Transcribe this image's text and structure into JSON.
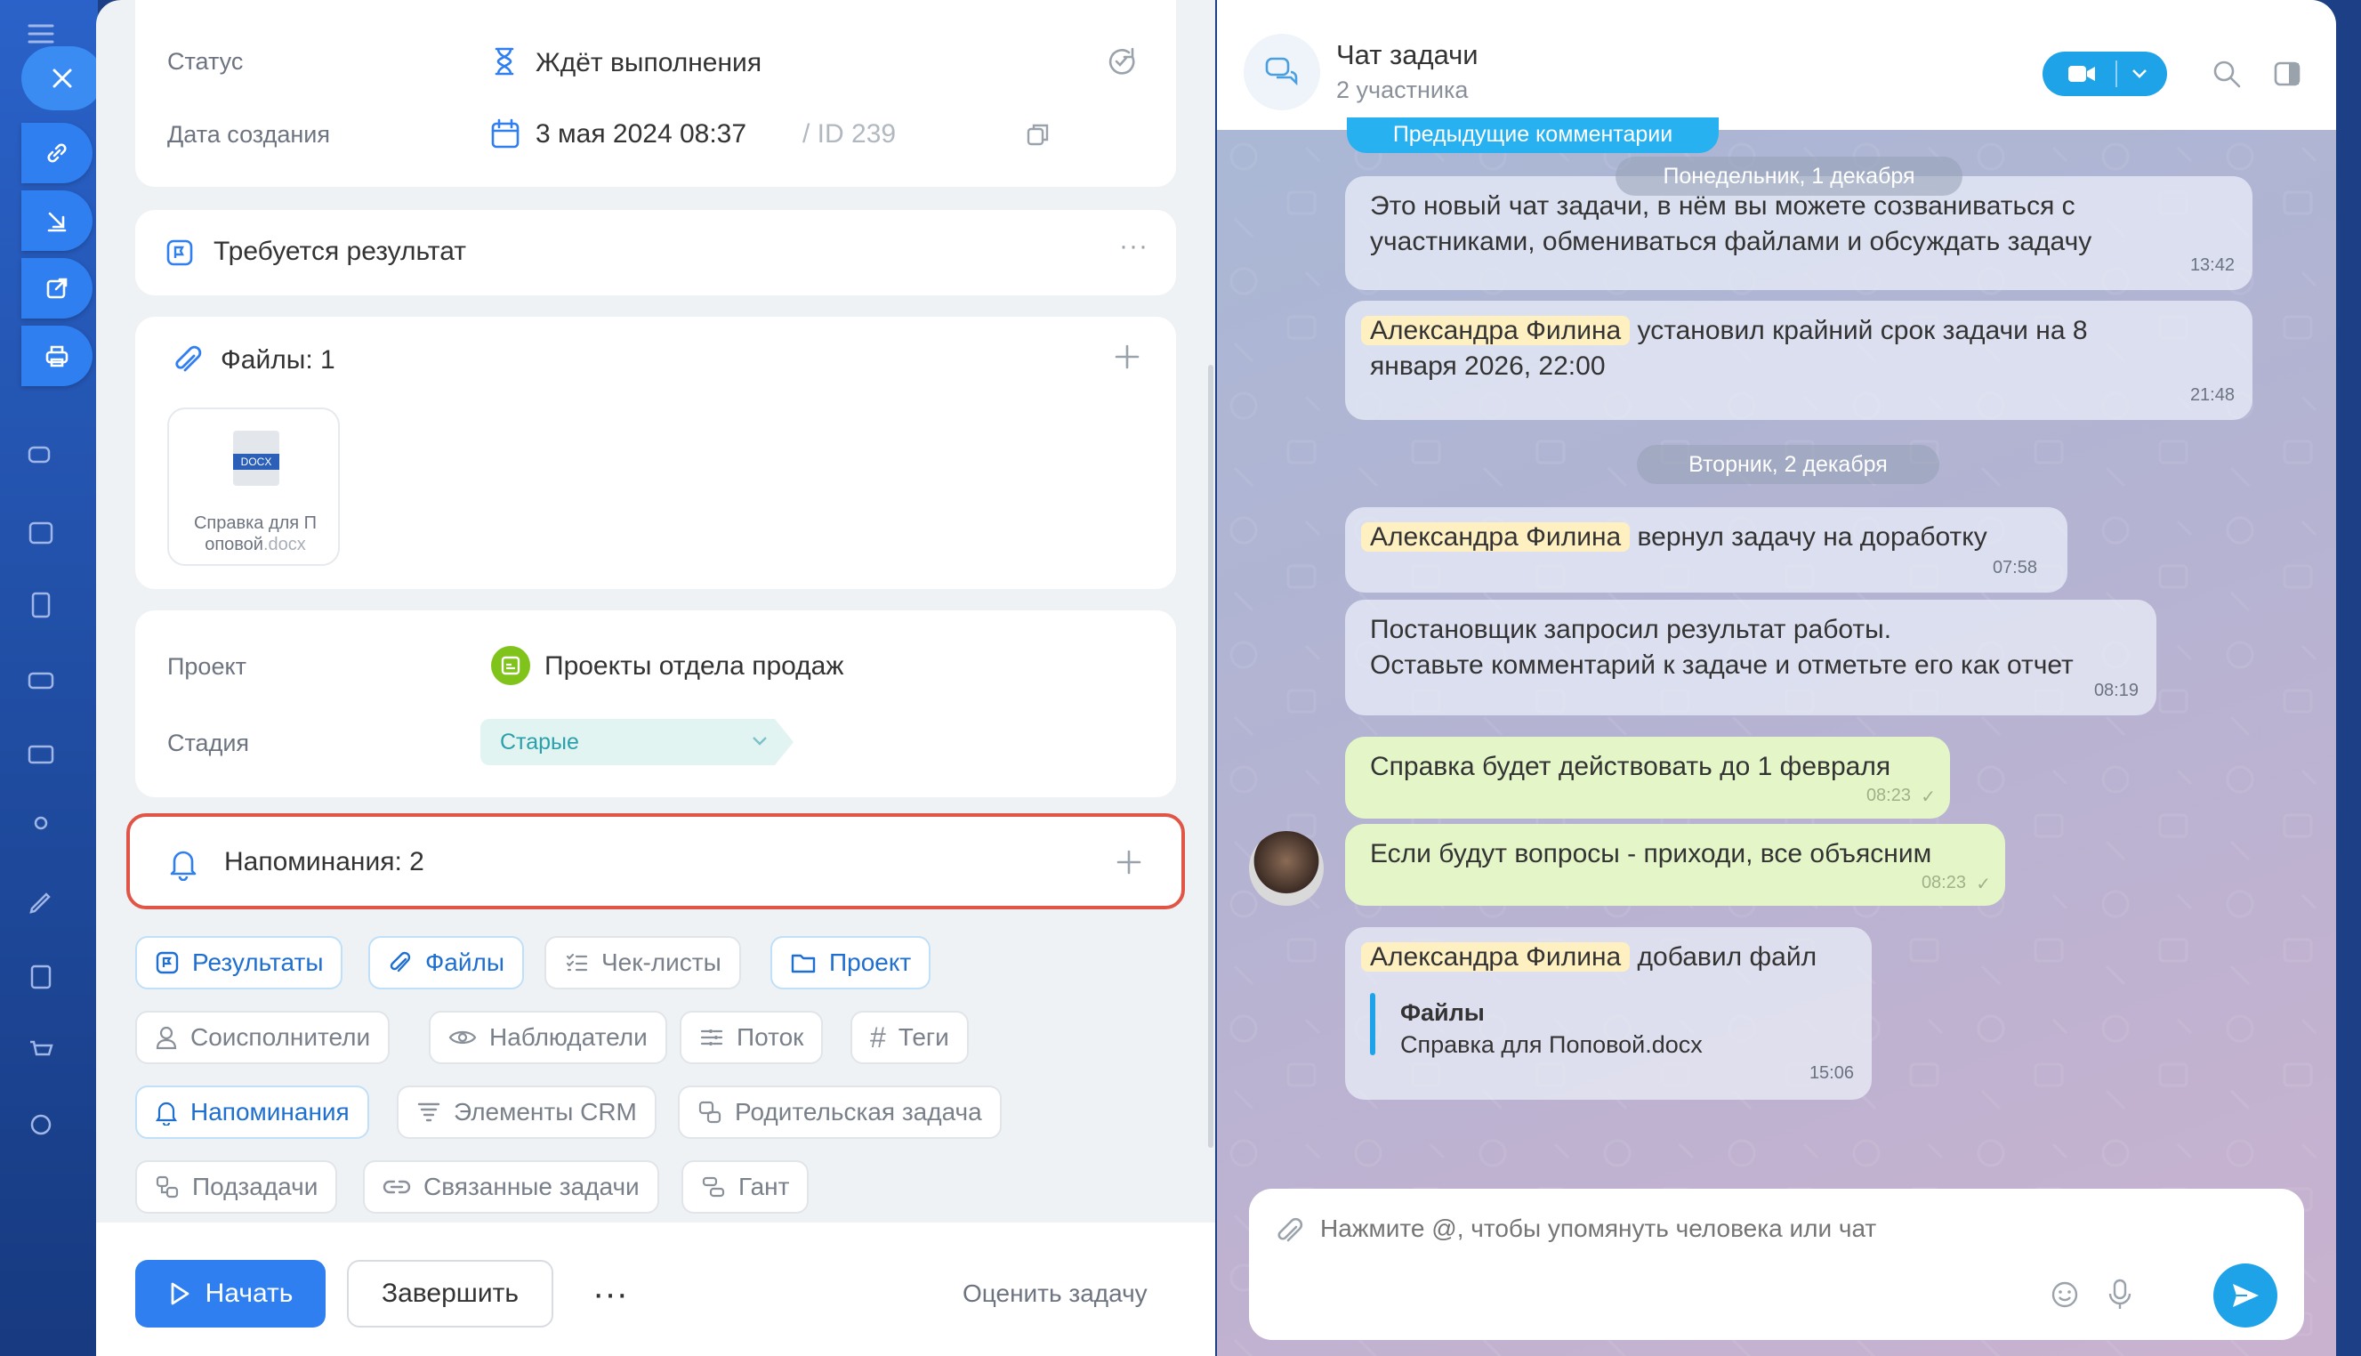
{
  "task": {
    "status_label": "Статус",
    "status_value": "Ждёт выполнения",
    "created_label": "Дата создания",
    "created_value": "3 мая 2024 08:37",
    "id_text": "/ ID 239",
    "result_required": "Требуется результат",
    "files_title": "Файлы: 1",
    "file_name_line1": "Справка для П",
    "file_name_line2": "оповой",
    "file_ext": ".docx",
    "file_badge": "DOCX",
    "project_label": "Проект",
    "project_value": "Проекты отдела продаж",
    "stage_label": "Стадия",
    "stage_value": "Старые",
    "reminders_title": "Напоминания: 2"
  },
  "pills": {
    "results": "Результаты",
    "files": "Файлы",
    "checklists": "Чек-листы",
    "project": "Проект",
    "coexecutors": "Соисполнители",
    "observers": "Наблюдатели",
    "flow": "Поток",
    "tags": "Теги",
    "reminders": "Напоминания",
    "crm": "Элементы CRM",
    "parent": "Родительская задача",
    "subtasks": "Подзадачи",
    "related": "Связанные задачи",
    "gantt": "Гант"
  },
  "footer": {
    "start": "Начать",
    "finish": "Завершить",
    "more": "···",
    "rate": "Оценить задачу"
  },
  "chat": {
    "title": "Чат задачи",
    "subtitle": "2 участника",
    "prev_comments": "Предыдущие комментарии",
    "date1": "Понедельник, 1 декабря",
    "date2": "Вторник, 2 декабря",
    "m1_line1": "Это новый чат задачи, в нём вы можете созваниваться с",
    "m1_line2": "участниками, обмениваться файлами и обсуждать задачу",
    "m1_time": "13:42",
    "author": "Александра Филина",
    "m2_text1": "установил крайний срок задачи на 8",
    "m2_text2": "января 2026, 22:00",
    "m2_time": "21:48",
    "m3_text": "вернул задачу на доработку",
    "m3_time": "07:58",
    "m4_line1": "Постановщик запросил результат работы.",
    "m4_line2": "Оставьте комментарий к задаче и отметьте его как отчет",
    "m4_time": "08:19",
    "m5_text": "Справка будет действовать до 1 февраля",
    "m5_time": "08:23",
    "m6_text": "Если будут вопросы - приходи, все объясним",
    "m6_time": "08:23",
    "m7_text": "добавил файл",
    "m7_file_title": "Файлы",
    "m7_file_name": "Справка для Поповой.docx",
    "m7_time": "15:06",
    "input_placeholder": "Нажмите @, чтобы упомянуть человека или чат"
  },
  "colors": {
    "accent": "#2f7ff0",
    "highlight": "#e05545",
    "green_bubble": "#e4f6c8",
    "chat_action": "#1ea3e8"
  }
}
